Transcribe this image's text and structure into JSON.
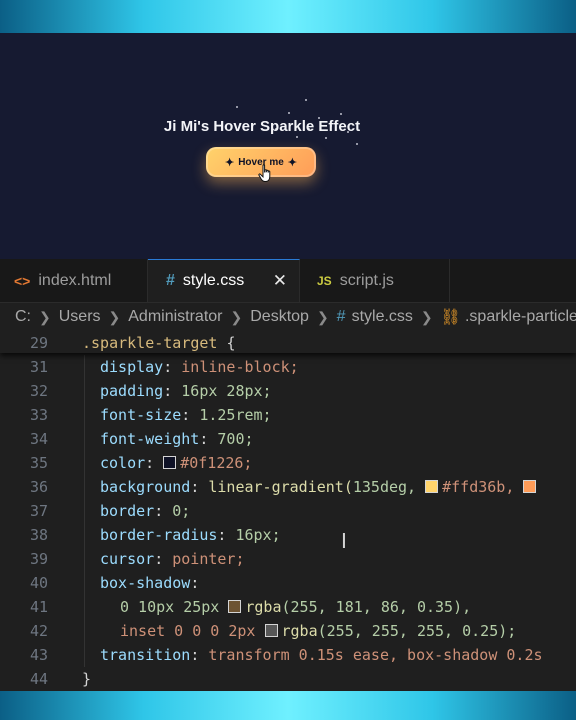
{
  "preview": {
    "title": "Ji Mi's Hover Sparkle Effect",
    "button_label": "Hover me",
    "spark_glyph": "✦"
  },
  "tabs": [
    {
      "icon": "<>",
      "label": "index.html"
    },
    {
      "icon": "#",
      "label": "style.css",
      "close": "✕"
    },
    {
      "icon": "JS",
      "label": "script.js"
    }
  ],
  "breadcrumb": [
    "C:",
    "Users",
    "Administrator",
    "Desktop",
    "style.css",
    ".sparkle-particle"
  ],
  "editor": {
    "sticky": {
      "num": "29",
      "selector": ".sparkle-target",
      "brace": "{"
    },
    "lines": [
      {
        "num": "31",
        "prop": "display",
        "value": "inline-block;"
      },
      {
        "num": "32",
        "prop": "padding",
        "value": "16px 28px;"
      },
      {
        "num": "33",
        "prop": "font-size",
        "value": "1.25rem;"
      },
      {
        "num": "34",
        "prop": "font-weight",
        "value": "700;"
      },
      {
        "num": "35",
        "prop": "color",
        "value": "#0f1226;"
      },
      {
        "num": "36",
        "prop": "background",
        "fn": "linear-gradient(",
        "args": "135deg,",
        "c1": "#ffd36b,"
      },
      {
        "num": "37",
        "prop": "border",
        "value": "0;"
      },
      {
        "num": "38",
        "prop": "border-radius",
        "value": "16px;"
      },
      {
        "num": "39",
        "prop": "cursor",
        "value": "pointer;"
      },
      {
        "num": "40",
        "prop": "box-shadow",
        "value": ""
      },
      {
        "num": "41",
        "pre": "0 10px 25px",
        "fn": "rgba",
        "args": "(255, 181, 86, 0.35),"
      },
      {
        "num": "42",
        "pre": "inset 0 0 0 2px",
        "fn": "rgba",
        "args": "(255, 255, 255, 0.25);"
      },
      {
        "num": "43",
        "prop": "transition",
        "value": "transform 0.15s ease, box-shadow 0.2s"
      },
      {
        "num": "44",
        "brace": "}"
      }
    ]
  },
  "colors": {
    "accent": "#2a7bd6",
    "swatch_text": "#0f1226",
    "swatch_bg1": "#ffd36b",
    "swatch_bg2": "#ff9c58",
    "swatch_shadow": "#ffb556",
    "swatch_inset": "#ffffff"
  }
}
